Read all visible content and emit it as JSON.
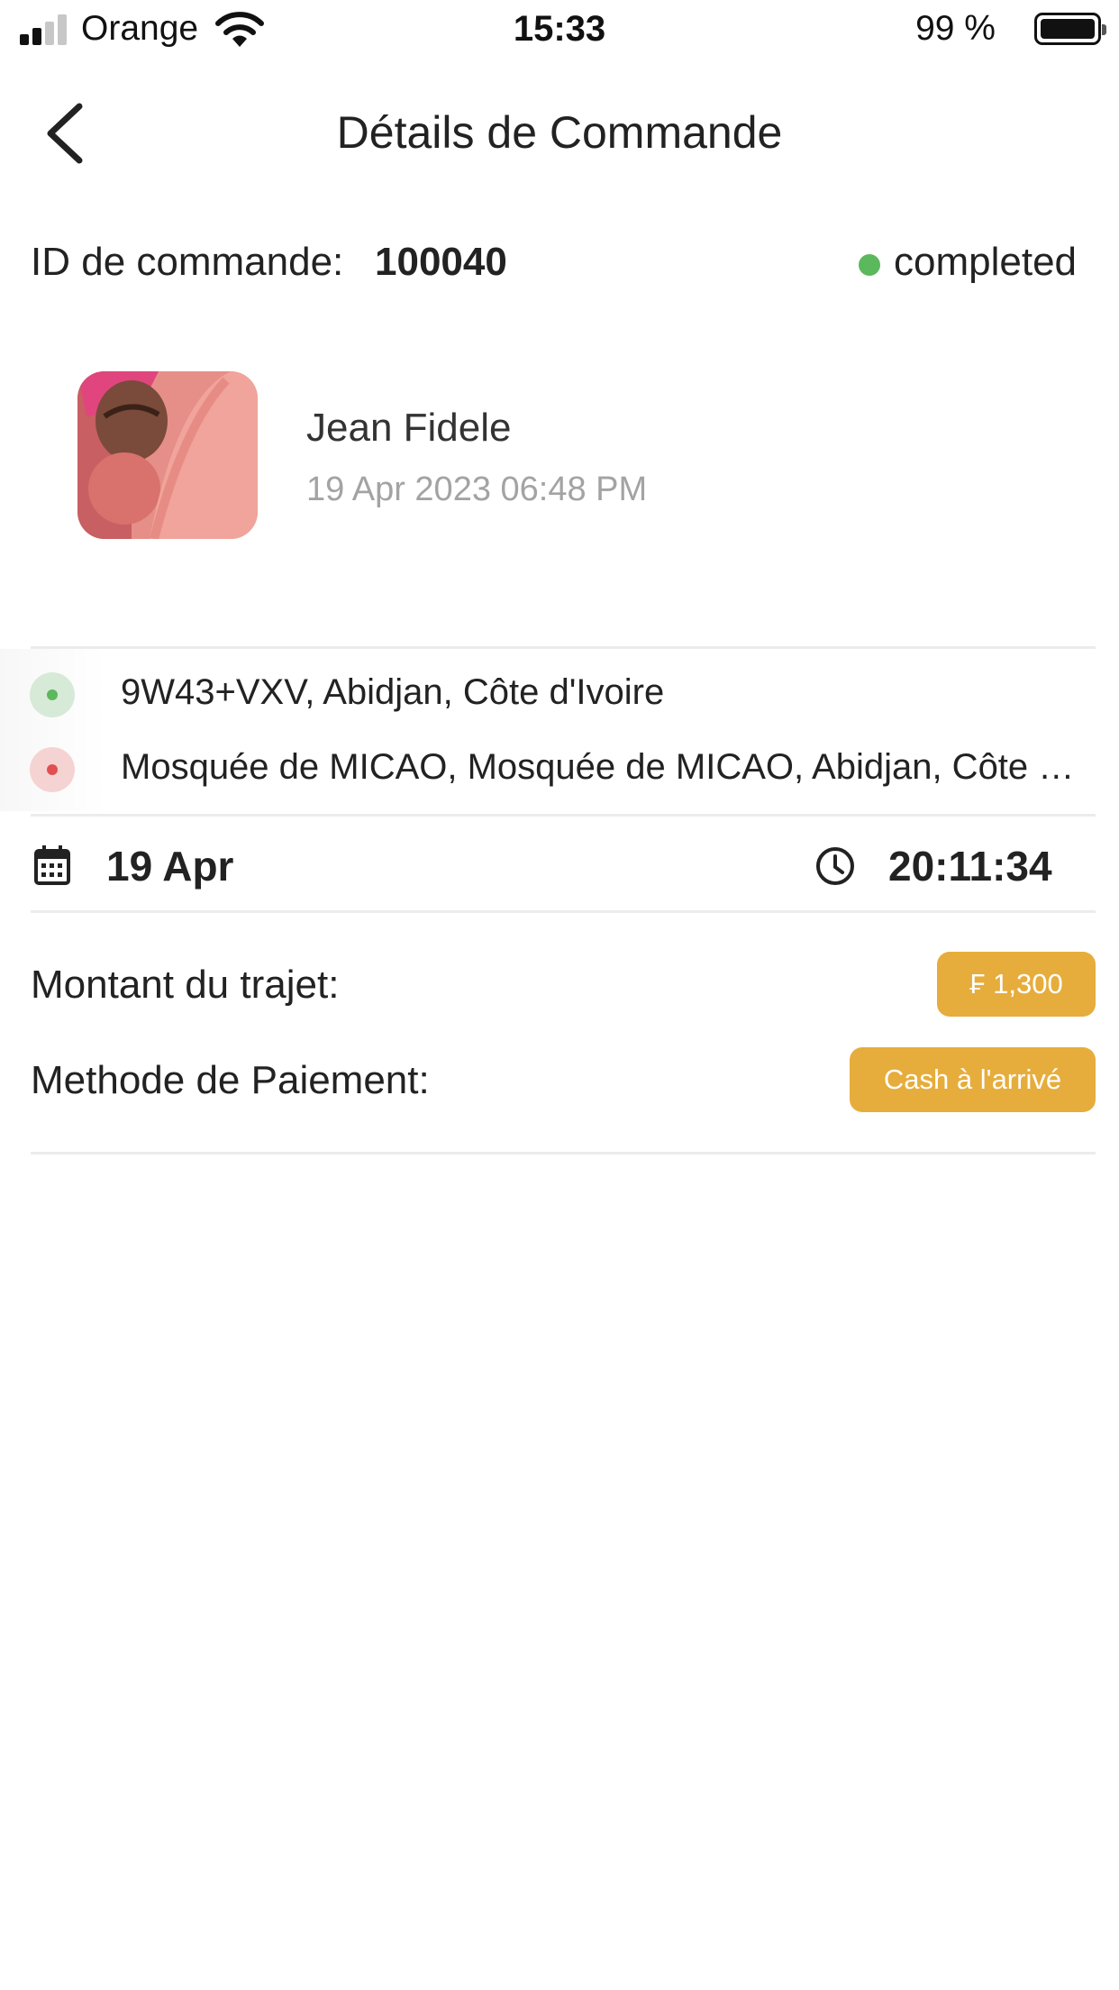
{
  "status_bar": {
    "carrier": "Orange",
    "time": "15:33",
    "battery": "99 %",
    "battery_level": 0.99,
    "signal_bars_active": 2,
    "signal_bars_total": 4
  },
  "header": {
    "title": "Détails de Commande",
    "back_icon": "chevron-left-icon"
  },
  "order": {
    "id_label": "ID de commande:",
    "id_value": "100040",
    "status": "completed",
    "status_color": "#5cb85c"
  },
  "customer": {
    "name": "Jean Fidele",
    "datetime": "19 Apr 2023  06:48 PM"
  },
  "route": {
    "pickup": "9W43+VXV, Abidjan, Côte d'Ivoire",
    "dropoff": "Mosquée de MICAO, Mosquée de MICAO, Abidjan, Côte d'Ivoire",
    "pickup_color": "#5cb85c",
    "dropoff_color": "#e05050"
  },
  "schedule": {
    "date": "19 Apr",
    "time": "20:11:34",
    "date_icon": "calendar-icon",
    "time_icon": "clock-icon"
  },
  "payment": {
    "amount_label": "Montant du trajet:",
    "amount_value": "₣ 1,300",
    "method_label": "Methode de Paiement:",
    "method_value": "Cash à l'arrivé",
    "accent_color": "#e6ad3c"
  }
}
